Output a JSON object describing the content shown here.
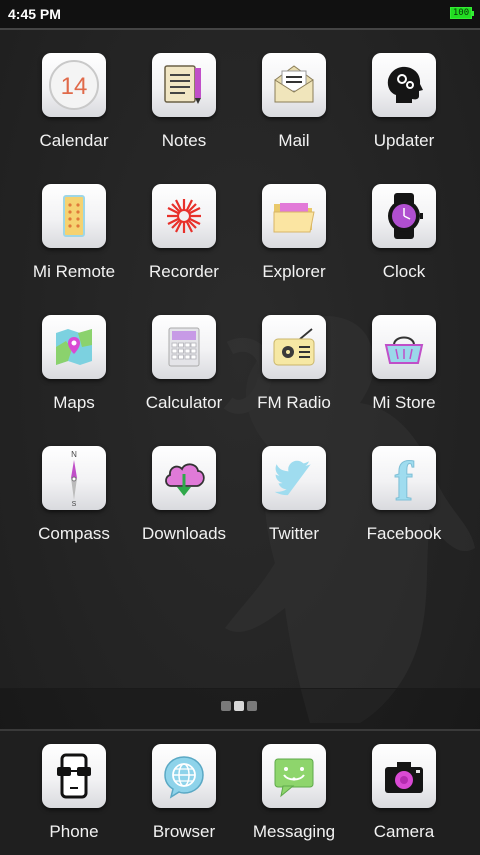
{
  "status_bar": {
    "time": "4:45 PM",
    "battery": "100"
  },
  "apps": [
    {
      "label": "Calendar",
      "icon": "calendar-icon",
      "day": "14"
    },
    {
      "label": "Notes",
      "icon": "notes-icon"
    },
    {
      "label": "Mail",
      "icon": "mail-icon"
    },
    {
      "label": "Updater",
      "icon": "updater-icon"
    },
    {
      "label": "Mi Remote",
      "icon": "mi-remote-icon"
    },
    {
      "label": "Recorder",
      "icon": "recorder-icon"
    },
    {
      "label": "Explorer",
      "icon": "explorer-icon"
    },
    {
      "label": "Clock",
      "icon": "clock-icon"
    },
    {
      "label": "Maps",
      "icon": "maps-icon"
    },
    {
      "label": "Calculator",
      "icon": "calculator-icon"
    },
    {
      "label": "FM Radio",
      "icon": "fm-radio-icon"
    },
    {
      "label": "Mi Store",
      "icon": "mi-store-icon"
    },
    {
      "label": "Compass",
      "icon": "compass-icon",
      "north": "N",
      "south": "S"
    },
    {
      "label": "Downloads",
      "icon": "downloads-icon"
    },
    {
      "label": "Twitter",
      "icon": "twitter-icon"
    },
    {
      "label": "Facebook",
      "icon": "facebook-icon",
      "glyph": "f"
    }
  ],
  "page_indicator": {
    "pages": 3,
    "current": 2
  },
  "dock": [
    {
      "label": "Phone",
      "icon": "phone-icon"
    },
    {
      "label": "Browser",
      "icon": "browser-icon"
    },
    {
      "label": "Messaging",
      "icon": "messaging-icon"
    },
    {
      "label": "Camera",
      "icon": "camera-icon"
    }
  ],
  "colors": {
    "background": "#262626",
    "accent_purple": "#b04fd0",
    "accent_green": "#22dd22"
  }
}
